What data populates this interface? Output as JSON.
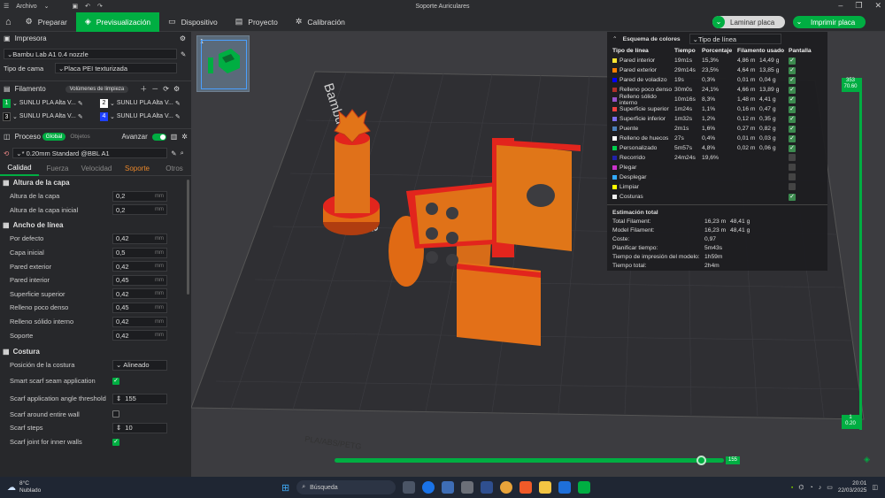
{
  "titlebar": {
    "menu": "Archivo",
    "title": "Soporte Auriculares"
  },
  "tabs": [
    {
      "label": "Preparar",
      "icon": "home"
    },
    {
      "label": "Previsualización",
      "icon": "preview"
    },
    {
      "label": "Dispositivo",
      "icon": "device"
    },
    {
      "label": "Proyecto",
      "icon": "project"
    },
    {
      "label": "Calibración",
      "icon": "calibration"
    }
  ],
  "actions": {
    "slice": "Laminar placa",
    "print": "Imprimir placa"
  },
  "printer": {
    "heading": "Impresora",
    "model": "Bambu Lab A1 0.4 nozzle",
    "bed_label": "Tipo de cama",
    "bed_value": "Placa PEI texturizada"
  },
  "filament": {
    "heading": "Filamento",
    "flush_button": "Volúmenes de limpieza",
    "slots": [
      {
        "num": "1",
        "name": "SUNLU PLA Alta V...",
        "color": "#00ae42"
      },
      {
        "num": "2",
        "name": "SUNLU PLA Alta V...",
        "color": "#ffffff"
      },
      {
        "num": "3",
        "name": "SUNLU PLA Alta V...",
        "color": "#111111"
      },
      {
        "num": "4",
        "name": "SUNLU PLA Alta V...",
        "color": "#1e40ff"
      }
    ]
  },
  "process": {
    "heading": "Proceso",
    "toggle_global": "Global",
    "toggle_objects": "Objetos",
    "advanced": "Avanzar",
    "profile": "* 0.20mm Standard @BBL A1",
    "subtabs": [
      "Calidad",
      "Fuerza",
      "Velocidad",
      "Soporte",
      "Otros"
    ]
  },
  "groups": {
    "layer_height": {
      "title": "Altura de la capa",
      "params": [
        {
          "label": "Altura de la capa",
          "value": "0,2",
          "unit": "mm"
        },
        {
          "label": "Altura de la capa inicial",
          "value": "0,2",
          "unit": "mm"
        }
      ]
    },
    "line_width": {
      "title": "Ancho de línea",
      "params": [
        {
          "label": "Por defecto",
          "value": "0,42",
          "unit": "mm"
        },
        {
          "label": "Capa inicial",
          "value": "0,5",
          "unit": "mm"
        },
        {
          "label": "Pared exterior",
          "value": "0,42",
          "unit": "mm"
        },
        {
          "label": "Pared interior",
          "value": "0,45",
          "unit": "mm"
        },
        {
          "label": "Superficie superior",
          "value": "0,42",
          "unit": "mm"
        },
        {
          "label": "Relleno poco denso",
          "value": "0,45",
          "unit": "mm"
        },
        {
          "label": "Relleno sólido interno",
          "value": "0,42",
          "unit": "mm"
        },
        {
          "label": "Soporte",
          "value": "0,42",
          "unit": "mm"
        }
      ]
    },
    "seam": {
      "title": "Costura",
      "position_label": "Posición de la costura",
      "position_value": "Alineado",
      "smart_scarf_label": "Smart scarf seam application",
      "smart_scarf_checked": true,
      "angle_label": "Scarf application angle threshold",
      "angle_value": "155",
      "entire_wall_label": "Scarf around entire wall",
      "entire_wall_checked": false,
      "steps_label": "Scarf steps",
      "steps_value": "10",
      "inner_walls_label": "Scarf joint for inner walls",
      "inner_walls_checked": true
    }
  },
  "plate": {
    "number": "1",
    "bed_text": "Bambu Textured PEI Plate",
    "bottom_text": "PLA/ABS/PETG"
  },
  "legend": {
    "title": "Esquema de colores",
    "scheme": "Tipo de línea",
    "headers": [
      "Tipo de línea",
      "Tiempo",
      "Porcentaje",
      "Filamento usado",
      "Pantalla"
    ],
    "rows": [
      {
        "name": "Pared interior",
        "color": "#ffe632",
        "time": "19m1s",
        "pct": "15,3%",
        "len": "4,86 m",
        "weight": "14,49 g",
        "shown": true
      },
      {
        "name": "Pared exterior",
        "color": "#ff7f00",
        "time": "29m14s",
        "pct": "23,5%",
        "len": "4,64 m",
        "weight": "13,85 g",
        "shown": true
      },
      {
        "name": "Pared de voladizo",
        "color": "#0000ff",
        "time": "19s",
        "pct": "0,3%",
        "len": "0,01 m",
        "weight": "0,04 g",
        "shown": true
      },
      {
        "name": "Relleno poco denso",
        "color": "#b03029",
        "time": "30m0s",
        "pct": "24,1%",
        "len": "4,66 m",
        "weight": "13,89 g",
        "shown": true
      },
      {
        "name": "Relleno sólido interno",
        "color": "#9654cc",
        "time": "10m16s",
        "pct": "8,3%",
        "len": "1,48 m",
        "weight": "4,41 g",
        "shown": true
      },
      {
        "name": "Superficie superior",
        "color": "#f04040",
        "time": "1m24s",
        "pct": "1,1%",
        "len": "0,16 m",
        "weight": "0,47 g",
        "shown": true
      },
      {
        "name": "Superficie inferior",
        "color": "#7d6ff0",
        "time": "1m32s",
        "pct": "1,2%",
        "len": "0,12 m",
        "weight": "0,35 g",
        "shown": true
      },
      {
        "name": "Puente",
        "color": "#4d80ba",
        "time": "2m1s",
        "pct": "1,6%",
        "len": "0,27 m",
        "weight": "0,82 g",
        "shown": true
      },
      {
        "name": "Relleno de huecos",
        "color": "#ffffff",
        "time": "27s",
        "pct": "0,4%",
        "len": "0,01 m",
        "weight": "0,03 g",
        "shown": true
      },
      {
        "name": "Personalizado",
        "color": "#00d14e",
        "time": "5m57s",
        "pct": "4,8%",
        "len": "0,02 m",
        "weight": "0,06 g",
        "shown": true
      },
      {
        "name": "Recorrido",
        "color": "#2222aa",
        "time": "24m24s",
        "pct": "19,6%",
        "len": "",
        "weight": "",
        "shown": false
      },
      {
        "name": "Plegar",
        "color": "#cc33cc",
        "time": "",
        "pct": "",
        "len": "",
        "weight": "",
        "shown": false
      },
      {
        "name": "Desplegar",
        "color": "#33aaff",
        "time": "",
        "pct": "",
        "len": "",
        "weight": "",
        "shown": false
      },
      {
        "name": "Limpiar",
        "color": "#ffff00",
        "time": "",
        "pct": "",
        "len": "",
        "weight": "",
        "shown": false
      },
      {
        "name": "Costuras",
        "color": "#f0f0f0",
        "time": "",
        "pct": "",
        "len": "",
        "weight": "",
        "shown": true
      }
    ],
    "totals_title": "Estimación total",
    "totals": [
      {
        "label": "Total Filament:",
        "v1": "16,23 m",
        "v2": "48,41 g"
      },
      {
        "label": "Model Filament:",
        "v1": "16,23 m",
        "v2": "48,41 g"
      },
      {
        "label": "Coste:",
        "v1": "0,97",
        "v2": ""
      },
      {
        "label": "Planificar tiempo:",
        "v1": "5m43s",
        "v2": ""
      },
      {
        "label": "Tiempo de impresión del modelo:",
        "v1": "1h59m",
        "v2": ""
      },
      {
        "label": "Tiempo total:",
        "v1": "2h4m",
        "v2": ""
      }
    ]
  },
  "layer_slider": {
    "top_value": "353",
    "top_height": "70.60",
    "bottom_value": "1",
    "bottom_height": "0.20"
  },
  "move_slider": {
    "value": "155",
    "position": 0.94
  },
  "taskbar": {
    "weather_temp": "8°C",
    "weather_desc": "Nublado",
    "search_placeholder": "Búsqueda",
    "time": "20:01",
    "date": "22/03/2025"
  }
}
